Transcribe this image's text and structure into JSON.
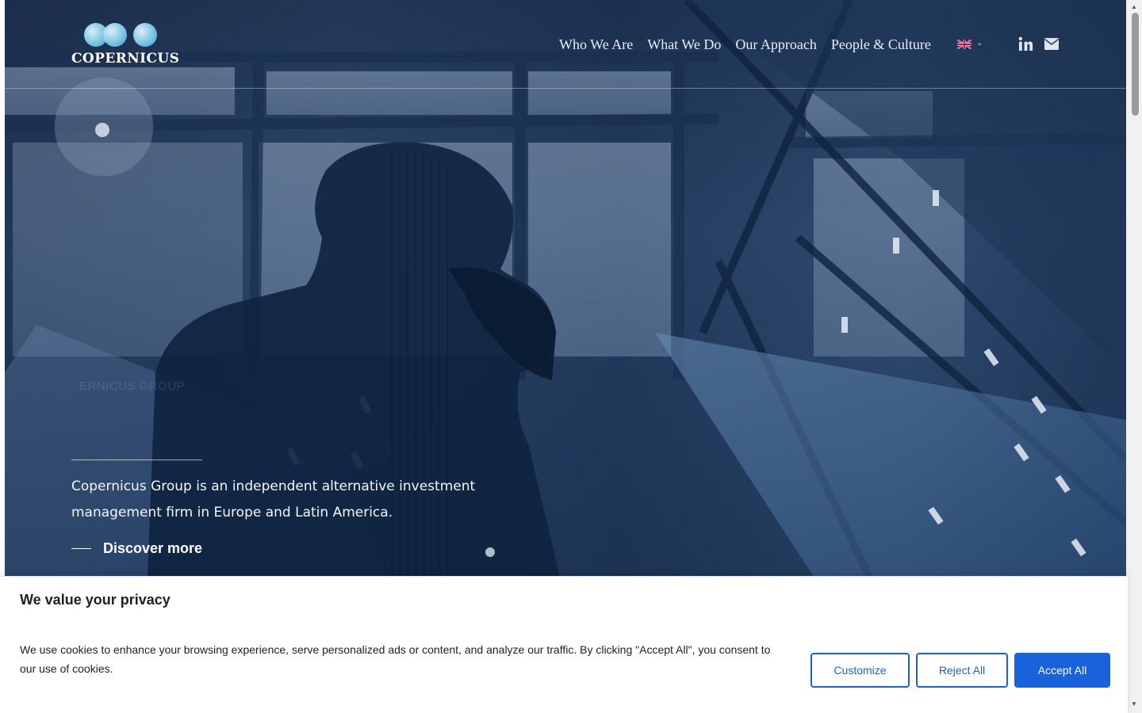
{
  "header": {
    "logo_text": "COPERNICUS",
    "nav": [
      {
        "label": "Who We Are"
      },
      {
        "label": "What We Do"
      },
      {
        "label": "Our Approach"
      },
      {
        "label": "People & Culture"
      }
    ],
    "language": {
      "icon": "uk-flag-icon",
      "chevron": "chevron-down-icon"
    },
    "social": [
      {
        "icon": "linkedin-icon"
      },
      {
        "icon": "envelope-icon"
      }
    ]
  },
  "hero": {
    "eyebrow": "ERNICUS GROUP",
    "tagline": "Copernicus Group is an independent alternative investment management firm in Europe and Latin America.",
    "cta": "Discover more"
  },
  "cookie_banner": {
    "title": "We value your privacy",
    "text": "We use cookies to enhance your browsing experience, serve personalized ads or content, and analyze our traffic. By clicking \"Accept All\", you consent to our use of cookies.",
    "buttons": {
      "customize": "Customize",
      "reject": "Reject All",
      "accept": "Accept All"
    }
  },
  "colors": {
    "brand_blue": "#1863dc",
    "logo_cyan": "#3fa7d6"
  }
}
